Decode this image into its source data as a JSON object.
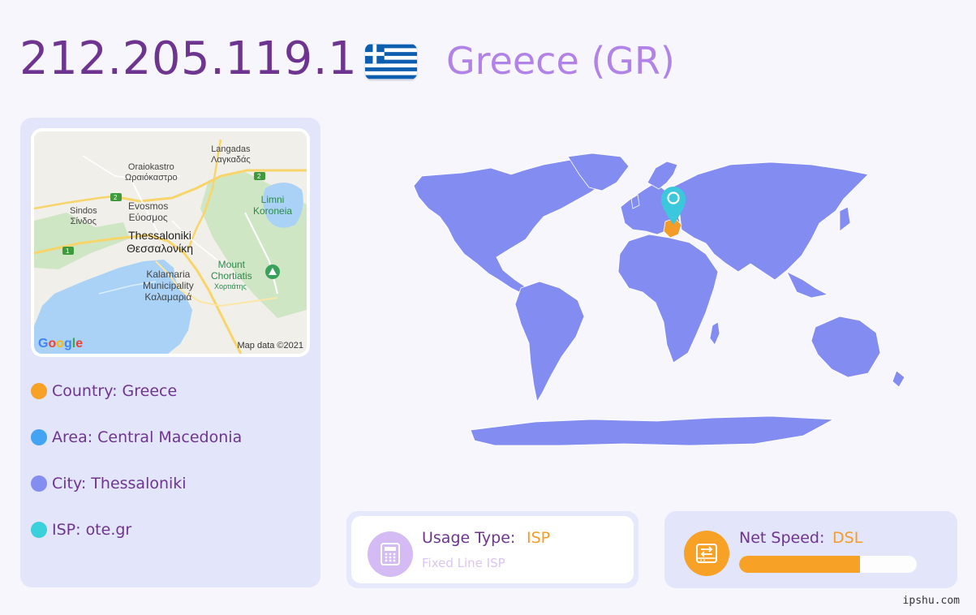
{
  "header": {
    "ip": "212.205.119.1",
    "country_title": "Greece (GR)"
  },
  "map": {
    "labels": {
      "langadas": "Langadas",
      "langadas_gr": "Λαγκαδάς",
      "oraiokastro": "Oraiokastro",
      "oraiokastro_gr": "Ωραιόκαστρο",
      "sindos": "Sindos",
      "sindos_gr": "Σίνδος",
      "evosmos": "Evosmos",
      "evosmos_gr": "Εύοσμος",
      "limni_koroneia": "Limni\nKoroneia",
      "thessaloniki": "Thessaloniki",
      "thessaloniki_gr": "Θεσσαλονίκη",
      "mount_chortiatis": "Mount\nChortiatis",
      "chortiatis_gr": "Χορτιάτης",
      "kalamaria": "Kalamaria\nMunicipality\nΚαλαμαριά",
      "road_2a": "2",
      "road_2b": "2",
      "road_1": "1"
    },
    "logo": "Google",
    "credit": "Map data ©2021"
  },
  "info": {
    "country": "Country: Greece",
    "area": "Area: Central Macedonia",
    "city": "City: Thessaloniki",
    "isp": "ISP: ote.gr"
  },
  "usage": {
    "label": "Usage Type:",
    "value": "ISP",
    "sub": "Fixed Line ISP"
  },
  "speed": {
    "label": "Net Speed:",
    "value": "DSL",
    "level": 0.68
  },
  "colors": {
    "country_dot": "#f7a127",
    "area_dot": "#43a4f4",
    "city_dot": "#848ef0",
    "isp_dot": "#3ad0dc",
    "world_land": "#838cf0",
    "marker": "#3cc8dc",
    "highlight": "#f39c27"
  },
  "watermark": "ipshu.com"
}
